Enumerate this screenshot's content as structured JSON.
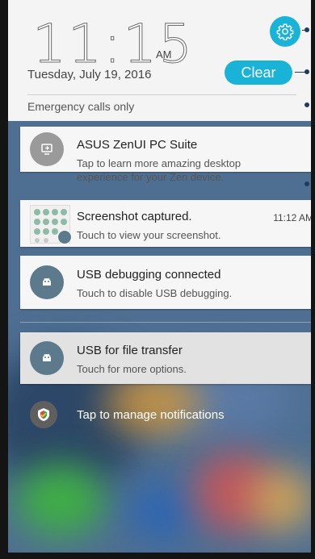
{
  "status_header": {
    "time": "11:15",
    "ampm": "AM",
    "date": "Tuesday, July 19, 2016",
    "clear_label": "Clear",
    "network_status": "Emergency calls only"
  },
  "notifications": [
    {
      "app": "ASUS ZenUI PC Suite",
      "body_line1": "Tap to learn more amazing desktop",
      "body_line2": "experience for your Zen device.",
      "icon": "pc-suite-icon"
    },
    {
      "app": "Screenshot captured.",
      "time": "11:12 AM",
      "body_line1": "Touch to view your screenshot.",
      "icon": "screenshot-thumbnail"
    },
    {
      "app": "USB debugging connected",
      "body_line1": "Touch to disable USB debugging.",
      "icon": "android-icon"
    },
    {
      "app": "USB for file transfer",
      "body_line1": "Touch for more options.",
      "icon": "android-icon"
    }
  ],
  "manage": {
    "label": "Tap to manage notifications",
    "icon": "shield-icon"
  },
  "colors": {
    "accent": "#19b3d8",
    "icon_circle": "#5c7a8c"
  }
}
